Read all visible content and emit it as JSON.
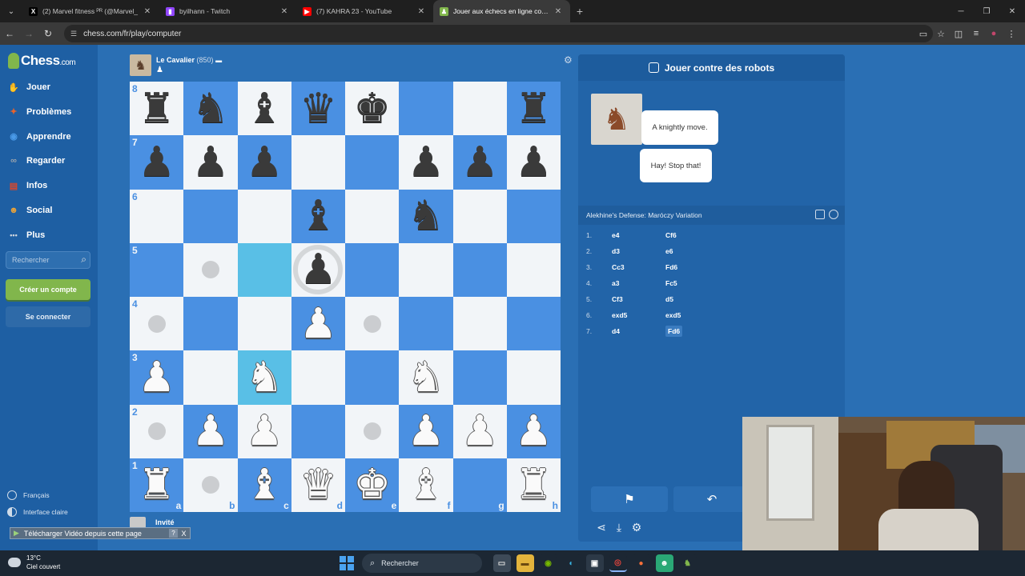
{
  "browser": {
    "tabs": [
      {
        "label": "(2) Marvel fitness ᴾᴿ (@Marvel_",
        "fav_text": "X",
        "fav_color": "#000000",
        "active": false
      },
      {
        "label": "byilhann - Twitch",
        "fav_text": "▮",
        "fav_color": "#9146ff",
        "active": false
      },
      {
        "label": "(7) KAHRA 23 - YouTube",
        "fav_text": "▶",
        "fav_color": "#ff0000",
        "active": false
      },
      {
        "label": "Jouer aux échecs en ligne contr",
        "fav_text": "♟",
        "fav_color": "#81b64c",
        "active": true
      }
    ],
    "url": "chess.com/fr/play/computer"
  },
  "sidebar": {
    "logo_main": "Chess",
    "logo_suffix": ".com",
    "items": [
      {
        "label": "Jouer",
        "icon": "play-hand-icon",
        "color": "#e07b39"
      },
      {
        "label": "Problèmes",
        "icon": "puzzle-icon",
        "color": "#e8632c"
      },
      {
        "label": "Apprendre",
        "icon": "learn-icon",
        "color": "#4a9ae8"
      },
      {
        "label": "Regarder",
        "icon": "binoculars-icon",
        "color": "#9aa3ad"
      },
      {
        "label": "Infos",
        "icon": "news-icon",
        "color": "#d9472b"
      },
      {
        "label": "Social",
        "icon": "social-icon",
        "color": "#e8a23a"
      },
      {
        "label": "Plus",
        "icon": "more-dots-icon",
        "color": "#cfd6de"
      }
    ],
    "search_placeholder": "Rechercher",
    "create_account": "Créer un compte",
    "login": "Se connecter",
    "footer": [
      {
        "label": "Français"
      },
      {
        "label": "Interface claire"
      }
    ]
  },
  "game": {
    "top_player": {
      "name": "Le Cavalier",
      "rating": "(850)",
      "captured": "♟"
    },
    "bottom_player": {
      "name": "Invité"
    },
    "board": [
      [
        "br",
        "bn",
        "bb",
        "bq",
        "bk",
        "",
        "",
        "br"
      ],
      [
        "bp",
        "bp",
        "bp",
        "",
        "",
        "bp",
        "bp",
        "bp"
      ],
      [
        "",
        "",
        "",
        "bb",
        "",
        "bn",
        "",
        ""
      ],
      [
        "",
        "dot",
        "hl",
        "bp_ring",
        "",
        "",
        "",
        ""
      ],
      [
        "dot",
        "",
        "",
        "wp",
        "dot",
        "",
        "",
        ""
      ],
      [
        "wp",
        "",
        "hlwn",
        "",
        "",
        "wn",
        "",
        ""
      ],
      [
        "dot",
        "wp",
        "wp",
        "",
        "dot",
        "wp",
        "wp",
        "wp"
      ],
      [
        "wr",
        "dot",
        "wb",
        "wq",
        "wk",
        "wb",
        "",
        "wr"
      ]
    ],
    "ranks": [
      "8",
      "7",
      "6",
      "5",
      "4",
      "3",
      "2",
      "1"
    ],
    "files": [
      "a",
      "b",
      "c",
      "d",
      "e",
      "f",
      "g",
      "h"
    ]
  },
  "panel": {
    "title": "Jouer contre des robots",
    "bubble1": "A knightly move.",
    "bubble2": "Hay! Stop that!",
    "opening": "Alekhine's Defense: Maróczy Variation",
    "moves": [
      {
        "n": "1.",
        "w": "e4",
        "b": "Cf6"
      },
      {
        "n": "2.",
        "w": "d3",
        "b": "e6"
      },
      {
        "n": "3.",
        "w": "Cc3",
        "b": "Fd6"
      },
      {
        "n": "4.",
        "w": "a3",
        "b": "Fc5"
      },
      {
        "n": "5.",
        "w": "Cf3",
        "b": "d5"
      },
      {
        "n": "6.",
        "w": "exd5",
        "b": "exd5"
      },
      {
        "n": "7.",
        "w": "d4",
        "b": "Fd6"
      }
    ]
  },
  "download_bar": {
    "label": "Télécharger Vidéo depuis cette page",
    "help": "?",
    "close": "X"
  },
  "taskbar": {
    "temp": "13°C",
    "weather": "Ciel couvert",
    "search": "Rechercher"
  }
}
